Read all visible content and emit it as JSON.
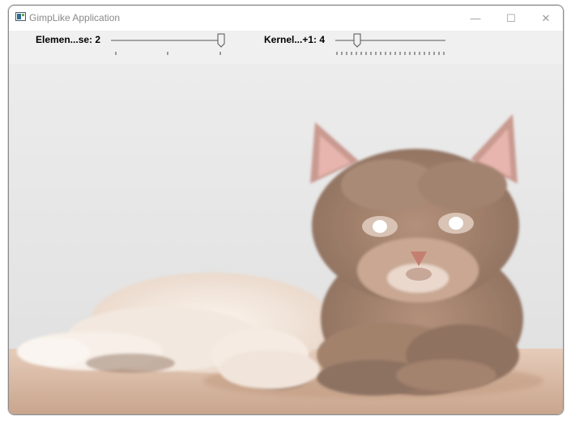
{
  "window": {
    "title": "GimpLike Application",
    "controls": {
      "minimize": "—",
      "maximize": "☐",
      "close": "✕"
    }
  },
  "toolbar": {
    "element_slider": {
      "label": "Elemen...se: 2",
      "value": 2
    },
    "kernel_slider": {
      "label": "Kernel...+1: 4",
      "value": 4
    }
  },
  "canvas": {
    "image_icon": "cat-photo-image",
    "colors": {
      "background": "#e9e9e9",
      "table": "#d9b8a2",
      "cat_fur": "#a88670",
      "white_fur": "#f2e6dc"
    }
  }
}
